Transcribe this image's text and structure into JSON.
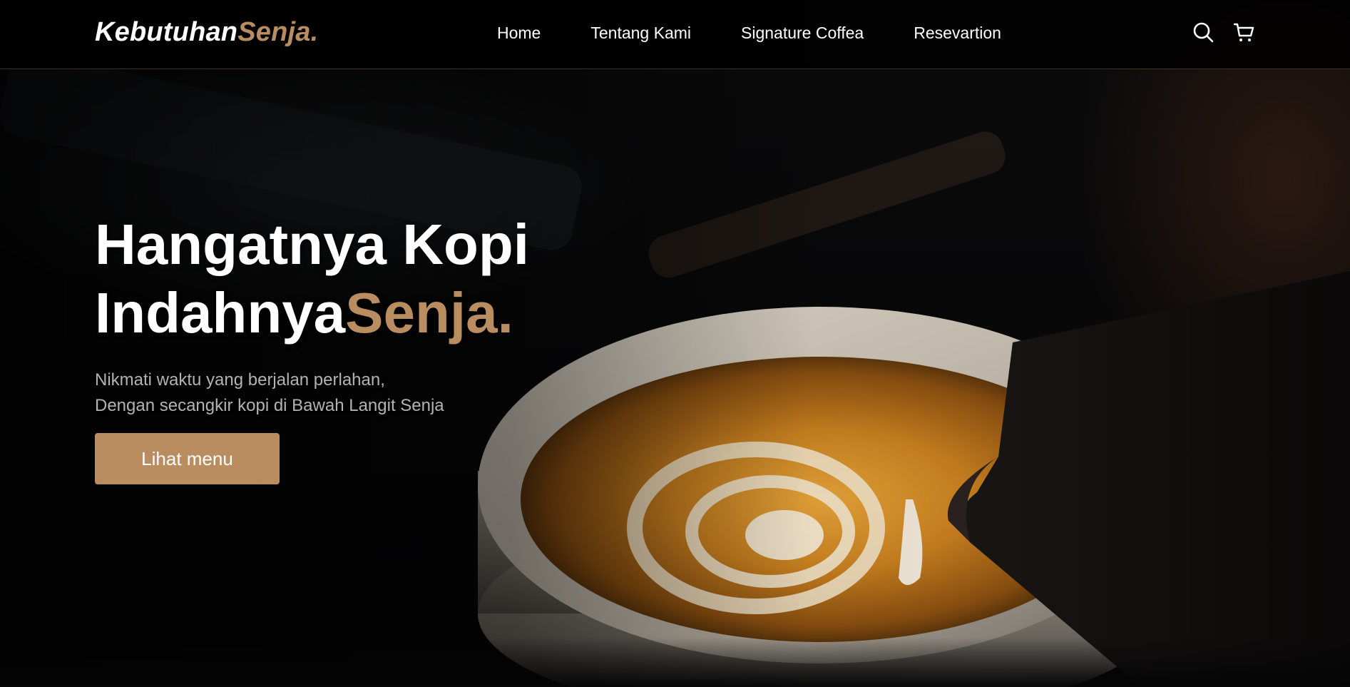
{
  "brand": {
    "name_main": "Kebutuhan",
    "name_accent": "Senja."
  },
  "nav": {
    "items": [
      {
        "label": "Home"
      },
      {
        "label": "Tentang Kami"
      },
      {
        "label": "Signature Coffea"
      },
      {
        "label": "Resevartion"
      }
    ],
    "icons": [
      "search-icon",
      "shopping-cart-icon"
    ]
  },
  "hero": {
    "title_line1": "Hangatnya Kopi",
    "title_line2_main": "Indahnya",
    "title_line2_accent": "Senja.",
    "subtitle_line1": "Nikmati waktu yang berjalan perlahan,",
    "subtitle_line2": "Dengan secangkir kopi di Bawah Langit Senja",
    "cta_label": "Lihat menu"
  },
  "colors": {
    "accent": "#b98d5f",
    "navbar_bg": "#000000",
    "text": "#ffffff",
    "subtitle": "#b3b3b3"
  }
}
